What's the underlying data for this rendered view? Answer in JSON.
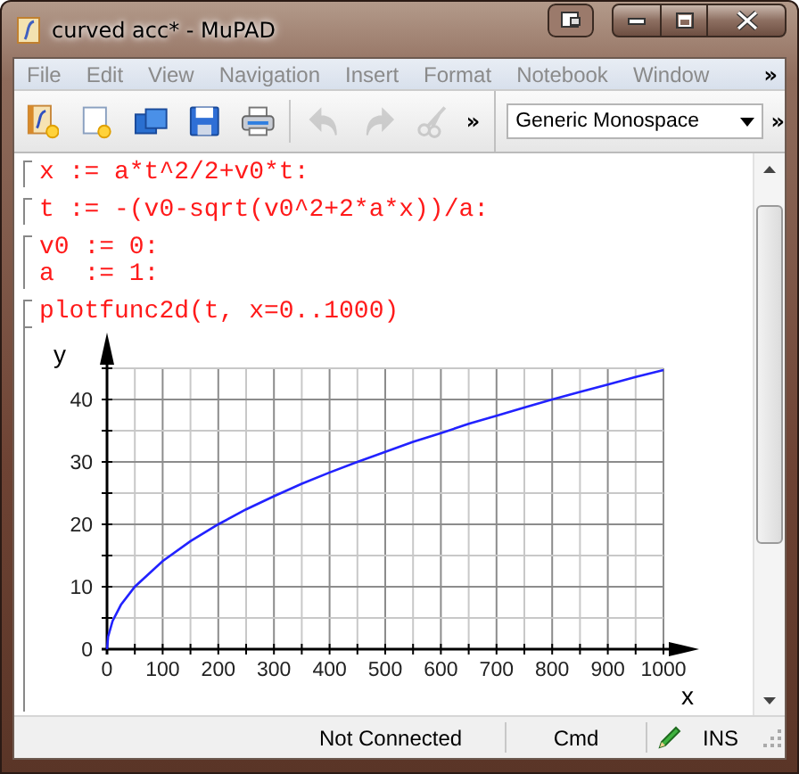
{
  "window": {
    "title": "curved acc* - MuPAD"
  },
  "menu": [
    "File",
    "Edit",
    "View",
    "Navigation",
    "Insert",
    "Format",
    "Notebook",
    "Window"
  ],
  "menu_overflow": "»",
  "toolbar": {
    "buttons": [
      {
        "kind": "new-notebook",
        "disabled": false
      },
      {
        "kind": "new-editor",
        "disabled": false
      },
      {
        "kind": "open",
        "disabled": false
      },
      {
        "kind": "save",
        "disabled": false
      },
      {
        "kind": "print",
        "disabled": false
      },
      {
        "kind": "undo",
        "disabled": true
      },
      {
        "kind": "redo",
        "disabled": true
      },
      {
        "kind": "cut",
        "disabled": true
      }
    ],
    "overflow": "»",
    "font_select": {
      "value": "Generic Monospace"
    },
    "overflow_2": "»"
  },
  "cells": [
    {
      "kind": "input",
      "lines": [
        "x := a*t^2/2+v0*t:"
      ]
    },
    {
      "kind": "input",
      "lines": [
        "t := -(v0-sqrt(v0^2+2*a*x))/a:"
      ]
    },
    {
      "kind": "input",
      "lines": [
        "v0 := 0:",
        "a  := 1:"
      ]
    },
    {
      "kind": "input",
      "lines": [
        "plotfunc2d(t, x=0..1000)"
      ]
    },
    {
      "kind": "plot",
      "chart_data": {
        "type": "line",
        "xlabel": "x",
        "ylabel": "y",
        "x": [
          0,
          2,
          10,
          25,
          50,
          100,
          150,
          200,
          250,
          300,
          350,
          400,
          450,
          500,
          550,
          600,
          650,
          700,
          750,
          800,
          850,
          900,
          950,
          1000
        ],
        "series": [
          {
            "color": "#2222ff",
            "values": [
              0,
              2,
              4.5,
              7.1,
              10,
              14.1,
              17.3,
              20,
              22.4,
              24.5,
              26.5,
              28.3,
              30,
              31.6,
              33.2,
              34.6,
              36.1,
              37.4,
              38.7,
              40,
              41.2,
              42.4,
              43.6,
              44.7
            ]
          }
        ],
        "xlim": [
          0,
          1000
        ],
        "ylim": [
          0,
          45
        ],
        "grid": true,
        "xticks": [
          0,
          100,
          200,
          300,
          400,
          500,
          600,
          700,
          800,
          900,
          1000
        ],
        "yticks": [
          0,
          10,
          20,
          30,
          40
        ]
      }
    }
  ],
  "status_bar": {
    "connection": "Not Connected",
    "mode": "Cmd",
    "insert": "INS"
  }
}
